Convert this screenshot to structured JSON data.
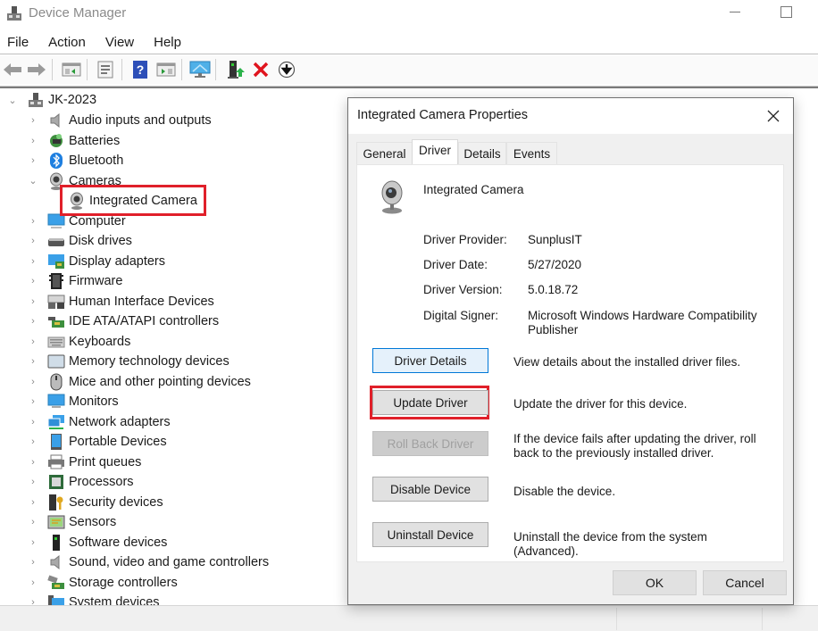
{
  "window": {
    "title": "Device Manager",
    "minimize_icon": "minimize-icon",
    "maximize_icon": "maximize-icon"
  },
  "menu": [
    "File",
    "Action",
    "View",
    "Help"
  ],
  "toolbar": {
    "buttons": [
      {
        "name": "back-icon"
      },
      {
        "name": "forward-icon"
      },
      {
        "name": "show-hide-console-tree-icon"
      },
      {
        "name": "properties-icon"
      },
      {
        "name": "help-icon"
      },
      {
        "name": "show-action-pane-icon"
      },
      {
        "name": "scan-hardware-changes-icon"
      },
      {
        "name": "update-driver-icon"
      },
      {
        "name": "uninstall-device-icon"
      },
      {
        "name": "disable-device-icon"
      }
    ]
  },
  "tree": {
    "root": "JK-2023",
    "categories": [
      {
        "label": "Audio inputs and outputs",
        "icon": "speaker-icon",
        "expanded": false
      },
      {
        "label": "Batteries",
        "icon": "battery-icon",
        "expanded": false
      },
      {
        "label": "Bluetooth",
        "icon": "bluetooth-icon",
        "expanded": false
      },
      {
        "label": "Cameras",
        "icon": "camera-icon",
        "expanded": true,
        "children": [
          "Integrated Camera"
        ]
      },
      {
        "label": "Computer",
        "icon": "computer-icon",
        "expanded": false
      },
      {
        "label": "Disk drives",
        "icon": "disk-drive-icon",
        "expanded": false
      },
      {
        "label": "Display adapters",
        "icon": "display-adapter-icon",
        "expanded": false
      },
      {
        "label": "Firmware",
        "icon": "firmware-icon",
        "expanded": false
      },
      {
        "label": "Human Interface Devices",
        "icon": "hid-icon",
        "expanded": false
      },
      {
        "label": "IDE ATA/ATAPI controllers",
        "icon": "ide-controller-icon",
        "expanded": false
      },
      {
        "label": "Keyboards",
        "icon": "keyboard-icon",
        "expanded": false
      },
      {
        "label": "Memory technology devices",
        "icon": "memory-icon",
        "expanded": false
      },
      {
        "label": "Mice and other pointing devices",
        "icon": "mouse-icon",
        "expanded": false
      },
      {
        "label": "Monitors",
        "icon": "monitor-icon",
        "expanded": false
      },
      {
        "label": "Network adapters",
        "icon": "network-adapter-icon",
        "expanded": false
      },
      {
        "label": "Portable Devices",
        "icon": "portable-device-icon",
        "expanded": false
      },
      {
        "label": "Print queues",
        "icon": "printer-icon",
        "expanded": false
      },
      {
        "label": "Processors",
        "icon": "processor-icon",
        "expanded": false
      },
      {
        "label": "Security devices",
        "icon": "security-device-icon",
        "expanded": false
      },
      {
        "label": "Sensors",
        "icon": "sensor-icon",
        "expanded": false
      },
      {
        "label": "Software devices",
        "icon": "software-device-icon",
        "expanded": false
      },
      {
        "label": "Sound, video and game controllers",
        "icon": "speaker-icon",
        "expanded": false
      },
      {
        "label": "Storage controllers",
        "icon": "storage-controller-icon",
        "expanded": false
      },
      {
        "label": "System devices",
        "icon": "system-device-icon",
        "expanded": false
      }
    ],
    "selected_child": "Integrated Camera"
  },
  "dialog": {
    "title": "Integrated Camera Properties",
    "tabs": [
      "General",
      "Driver",
      "Details",
      "Events"
    ],
    "active_tab": "Driver",
    "device_name": "Integrated Camera",
    "properties": [
      {
        "label": "Driver Provider:",
        "value": "SunplusIT"
      },
      {
        "label": "Driver Date:",
        "value": "5/27/2020"
      },
      {
        "label": "Driver Version:",
        "value": "5.0.18.72"
      },
      {
        "label": "Digital Signer:",
        "value": "Microsoft Windows Hardware Compatibility Publisher"
      }
    ],
    "actions": [
      {
        "label": "Driver Details",
        "description": "View details about the installed driver files.",
        "state": "focused"
      },
      {
        "label": "Update Driver",
        "description": "Update the driver for this device.",
        "state": "highlighted"
      },
      {
        "label": "Roll Back Driver",
        "description": "If the device fails after updating the driver, roll back to the previously installed driver.",
        "state": "disabled"
      },
      {
        "label": "Disable Device",
        "description": "Disable the device.",
        "state": "normal"
      },
      {
        "label": "Uninstall Device",
        "description": "Uninstall the device from the system (Advanced).",
        "state": "normal"
      }
    ],
    "ok_label": "OK",
    "cancel_label": "Cancel"
  },
  "colors": {
    "highlight_border": "#e0202a",
    "focus_blue": "#0078d7"
  }
}
